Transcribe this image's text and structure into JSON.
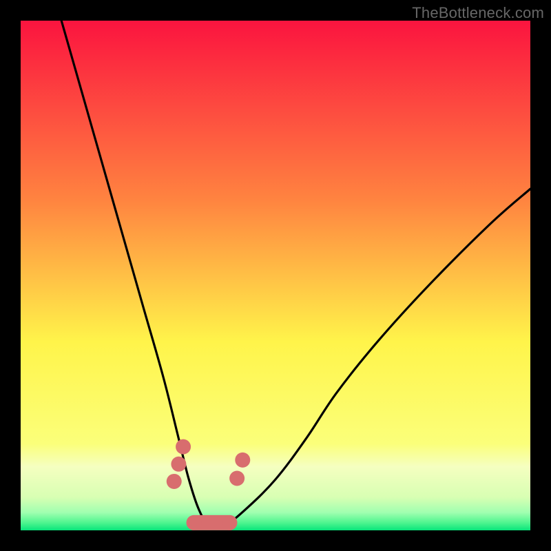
{
  "watermark": "TheBottleneck.com",
  "colors": {
    "frame_bg": "#000000",
    "gradient_top": "#fb143f",
    "gradient_mid1": "#ff8340",
    "gradient_mid2": "#fff44a",
    "gradient_mid3": "#fbff7a",
    "gradient_bottom": "#08e57b",
    "curve_stroke": "#000000",
    "salmon": "#d86d6e"
  },
  "chart_data": {
    "type": "line",
    "title": "",
    "xlabel": "",
    "ylabel": "",
    "xlim": [
      0,
      100
    ],
    "ylim": [
      0,
      100
    ],
    "series": [
      {
        "name": "bottleneck-curve",
        "x": [
          8,
          12,
          16,
          20,
          24,
          28,
          31,
          33,
          35,
          37,
          40,
          44,
          50,
          56,
          62,
          70,
          80,
          92,
          100
        ],
        "y": [
          100,
          86,
          72,
          58,
          44,
          30,
          18,
          10,
          4,
          1,
          1,
          4,
          10,
          18,
          27,
          37,
          48,
          60,
          67
        ]
      }
    ],
    "annotations": [
      {
        "name": "salmon-blob-left",
        "shape": "circles-cluster",
        "approx_x": 31,
        "approx_y": 13,
        "count": 3
      },
      {
        "name": "salmon-blob-right",
        "shape": "circles-cluster",
        "approx_x": 43,
        "approx_y": 12,
        "count": 2
      },
      {
        "name": "salmon-base-bar",
        "shape": "rounded-bar",
        "x_range": [
          34,
          41
        ],
        "approx_y": 1.5
      }
    ],
    "background_gradient": {
      "direction": "vertical",
      "stops": [
        {
          "pos": 0.0,
          "color": "#fb143f"
        },
        {
          "pos": 0.35,
          "color": "#ff8340"
        },
        {
          "pos": 0.63,
          "color": "#fff44a"
        },
        {
          "pos": 0.83,
          "color": "#fbff7a"
        },
        {
          "pos": 0.875,
          "color": "#f5ffc0"
        },
        {
          "pos": 0.935,
          "color": "#d8ffb3"
        },
        {
          "pos": 0.965,
          "color": "#a0ffb0"
        },
        {
          "pos": 0.985,
          "color": "#4ff58f"
        },
        {
          "pos": 1.0,
          "color": "#08e57b"
        }
      ]
    }
  }
}
